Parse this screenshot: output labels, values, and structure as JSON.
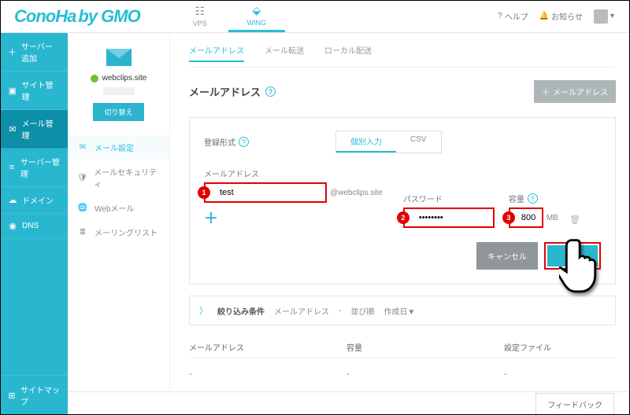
{
  "brand": {
    "name": "ConoHa",
    "sub": "by GMO"
  },
  "top_tabs": {
    "vps": "VPS",
    "wing": "WING"
  },
  "header": {
    "help": "ヘルプ",
    "notice": "お知らせ"
  },
  "sidebar": {
    "items": [
      {
        "icon": "＋",
        "label": "サーバー追加"
      },
      {
        "icon": "▣",
        "label": "サイト管理"
      },
      {
        "icon": "✉",
        "label": "メール管理"
      },
      {
        "icon": "≡",
        "label": "サーバー管理"
      },
      {
        "icon": "☁",
        "label": "ドメイン"
      },
      {
        "icon": "◉",
        "label": "DNS"
      }
    ],
    "sitemap": "サイトマップ"
  },
  "panel2": {
    "domain": "webclips.site",
    "switch": "切り替え",
    "items": [
      {
        "icon": "✉",
        "label": "メール設定"
      },
      {
        "icon": "🛡",
        "label": "メールセキュリティ"
      },
      {
        "icon": "🌐",
        "label": "Webメール"
      },
      {
        "icon": "≣",
        "label": "メーリングリスト"
      }
    ]
  },
  "inner_tabs": {
    "addr": "メールアドレス",
    "fwd": "メール転送",
    "local": "ローカル配送"
  },
  "page_title": "メールアドレス",
  "add_button": "メールアドレス",
  "form": {
    "reg_label": "登録形式",
    "seg": {
      "individual": "個別入力",
      "csv": "CSV"
    },
    "addr_label": "メールアドレス",
    "addr_value": "test",
    "addr_suffix": "@webclips.site",
    "pwd_label": "パスワード",
    "pwd_value": "••••••••",
    "cap_label": "容量",
    "cap_value": "800",
    "cap_unit": "MB",
    "cancel": "キャンセル",
    "save": "保存",
    "badges": {
      "b1": "1",
      "b2": "2",
      "b3": "3"
    }
  },
  "filter": {
    "label": "絞り込み条件",
    "f1": "メールアドレス",
    "sep": "-",
    "f2": "並び順",
    "f3": "作成日▼"
  },
  "table": {
    "h1": "メールアドレス",
    "h2": "容量",
    "h3": "設定ファイル",
    "empty": "-"
  },
  "footer": {
    "feedback": "フィードバック"
  }
}
